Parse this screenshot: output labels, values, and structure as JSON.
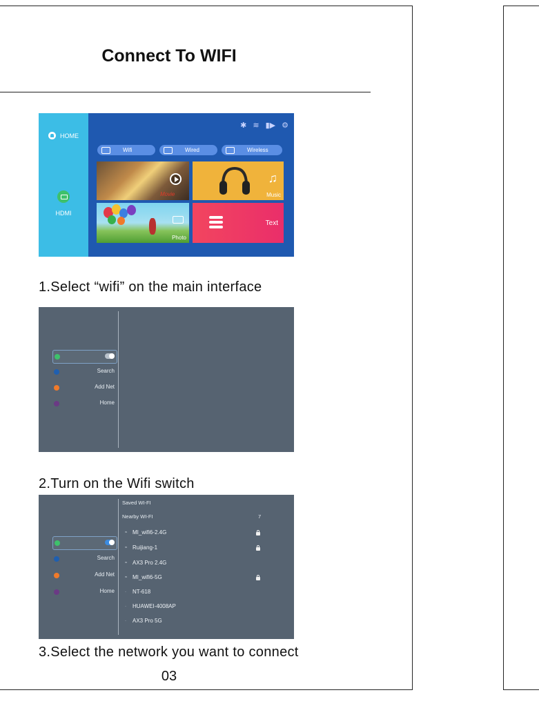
{
  "page": {
    "title": "Connect To WIFI",
    "page_number": "03"
  },
  "steps": [
    {
      "caption": "1.Select “wifi” on the main interface"
    },
    {
      "caption": "2.Turn on the Wifi switch"
    },
    {
      "caption": "3.Select the network you want to connect"
    }
  ],
  "home_screen": {
    "sidebar": {
      "home_label": "HOME",
      "hdmi_label": "HDMI"
    },
    "status_icons": [
      "bluetooth-icon",
      "wifi-off-icon",
      "battery-icon",
      "settings-icon"
    ],
    "connection_buttons": [
      "Wifi",
      "Wired",
      "Wireless"
    ],
    "tiles": {
      "movie": "Movie",
      "music": "Music",
      "photo": "Photo",
      "text": "Text"
    },
    "colors": {
      "sidebar": "#3cbde6",
      "main": "#1f59b0",
      "music": "#f0b33b",
      "text": "#f2455f"
    }
  },
  "settings_menu": {
    "items": [
      {
        "label": "",
        "dot_color": "#3ec16b",
        "toggle": true
      },
      {
        "label": "Search",
        "dot_color": "#1f5fb0"
      },
      {
        "label": "Add Net",
        "dot_color": "#f07a2a"
      },
      {
        "label": "Home",
        "dot_color": "#6b3a85"
      }
    ],
    "wifi_on": true
  },
  "wifi_list": {
    "saved_header": "Saved WI-FI",
    "nearby_header": "Nearby WI-FI",
    "nearby_count": "7",
    "networks": [
      {
        "name": "MI_wifi6-2.4G",
        "locked": true
      },
      {
        "name": "Ruijiang-1",
        "locked": true
      },
      {
        "name": "AX3 Pro 2.4G",
        "locked": false
      },
      {
        "name": "MI_wifi6-5G",
        "locked": true
      },
      {
        "name": "NT-618",
        "locked": false
      },
      {
        "name": "HUAWEI-4008AP",
        "locked": false
      },
      {
        "name": "AX3 Pro 5G",
        "locked": false
      }
    ]
  }
}
